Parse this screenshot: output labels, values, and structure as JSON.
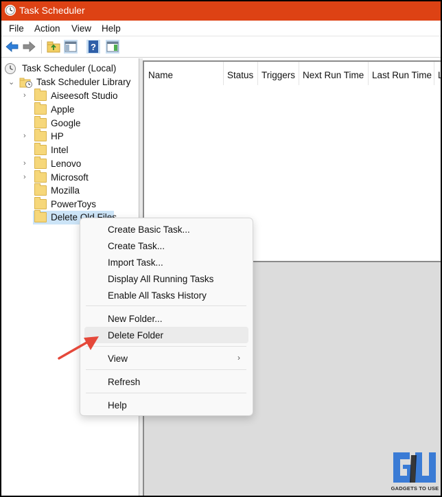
{
  "window": {
    "title": "Task Scheduler",
    "accent": "#dd4214"
  },
  "menubar": {
    "items": [
      "File",
      "Action",
      "View",
      "Help"
    ]
  },
  "toolbar": {
    "icons": [
      "back-arrow-icon",
      "forward-arrow-icon",
      "up-folder-icon",
      "show-hide-pane-icon",
      "help-icon",
      "show-action-pane-icon"
    ]
  },
  "tree": {
    "root": "Task Scheduler (Local)",
    "library": "Task Scheduler Library",
    "folders": [
      {
        "label": "Aiseesoft Studio",
        "expandable": true
      },
      {
        "label": "Apple",
        "expandable": false
      },
      {
        "label": "Google",
        "expandable": false
      },
      {
        "label": "HP",
        "expandable": true
      },
      {
        "label": "Intel",
        "expandable": false
      },
      {
        "label": "Lenovo",
        "expandable": true
      },
      {
        "label": "Microsoft",
        "expandable": true
      },
      {
        "label": "Mozilla",
        "expandable": false
      },
      {
        "label": "PowerToys",
        "expandable": false
      },
      {
        "label": "Delete Old Files",
        "expandable": false,
        "selected": true
      }
    ]
  },
  "task_list": {
    "columns": [
      "Name",
      "Status",
      "Triggers",
      "Next Run Time",
      "Last Run Time",
      "L"
    ]
  },
  "context_menu": {
    "items": [
      "Create Basic Task...",
      "Create Task...",
      "Import Task...",
      "Display All Running Tasks",
      "Enable All Tasks History",
      "New Folder...",
      "Delete Folder",
      "View",
      "Refresh",
      "Help"
    ],
    "highlighted": "Delete Folder"
  },
  "watermark": {
    "text": "GADGETS TO USE",
    "colors": [
      "#3a7bd5",
      "#1a1a1a"
    ]
  }
}
